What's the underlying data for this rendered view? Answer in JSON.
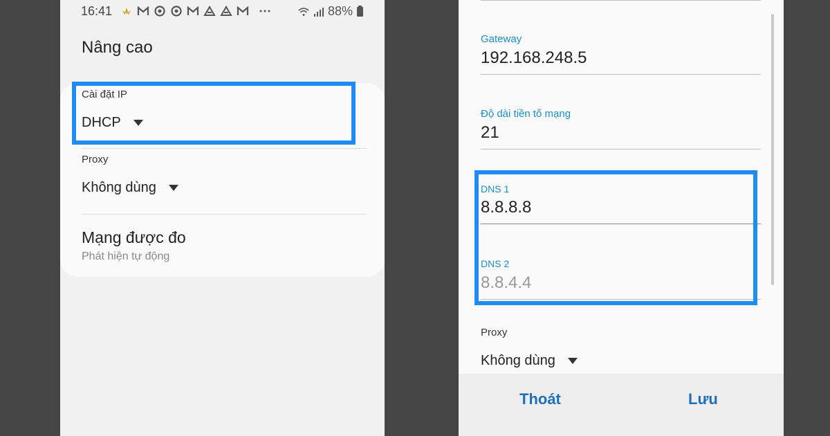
{
  "left": {
    "status": {
      "time": "16:41",
      "battery": "88%",
      "icons": [
        "lotus-icon",
        "gmail-icon",
        "chrome-icon",
        "chrome-icon",
        "gmail-icon",
        "drive-icon",
        "drive-icon",
        "gmail-icon",
        "more-dots-icon"
      ]
    },
    "title": "Nâng cao",
    "ip_settings": {
      "label": "Cài đặt IP",
      "value": "DHCP"
    },
    "proxy": {
      "label": "Proxy",
      "value": "Không dùng"
    },
    "metered": {
      "label": "Mạng được đo",
      "subtext": "Phát hiện tự động"
    }
  },
  "right": {
    "gateway": {
      "label": "Gateway",
      "value": "192.168.248.5"
    },
    "prefix": {
      "label": "Độ dài tiền tố mạng",
      "value": "21"
    },
    "dns1": {
      "label": "DNS 1",
      "value": "8.8.8.8"
    },
    "dns2": {
      "label": "DNS 2",
      "value": "8.8.4.4"
    },
    "proxy": {
      "label": "Proxy",
      "value": "Không dùng"
    },
    "footer": {
      "cancel": "Thoát",
      "save": "Lưu"
    }
  },
  "colors": {
    "highlight": "#1e8cf0",
    "accent_label": "#1a8fc9",
    "button": "#1e6fb8"
  }
}
